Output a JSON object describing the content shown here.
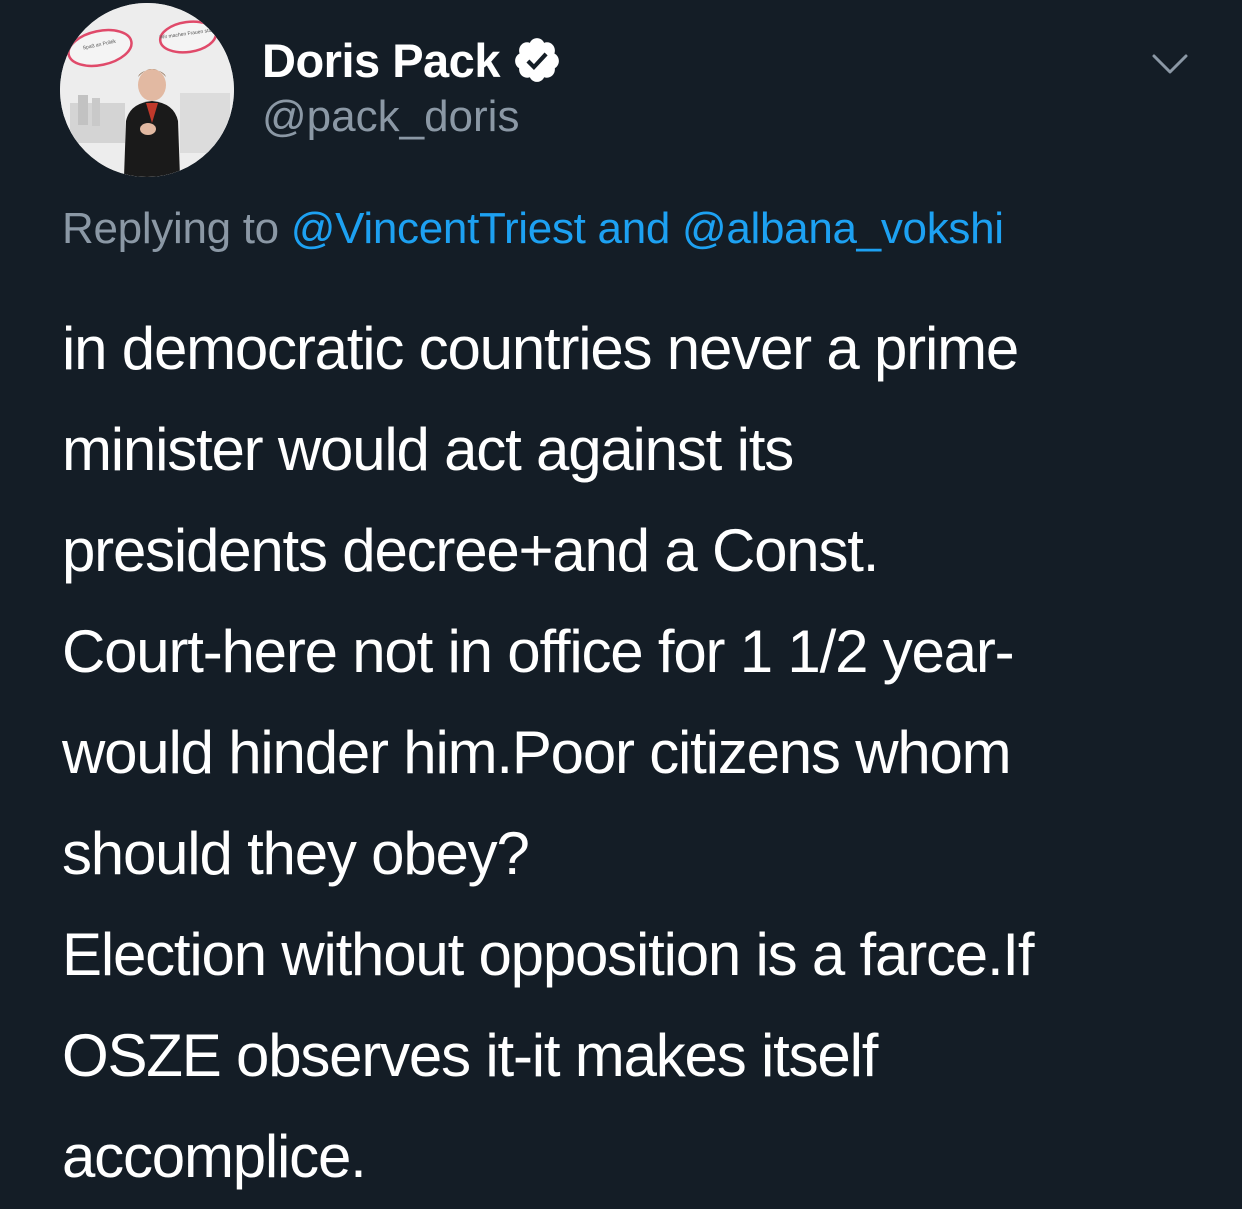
{
  "author": {
    "display_name": "Doris Pack",
    "handle": "@pack_doris",
    "verified": true,
    "avatar_signs": [
      "Spaß an Politik",
      "Wir machen Frauen stark"
    ]
  },
  "reply": {
    "prefix": "Replying to",
    "mention_1": "@VincentTriest",
    "conjunction": "and",
    "mention_2": "@albana_vokshi"
  },
  "body": {
    "lines": [
      "in democratic countries never a prime",
      "minister would act against its",
      "presidents decree+and a Const.",
      "Court-here not in office for 1 1/2 year-",
      "would hinder him.Poor citizens whom",
      "should they obey?",
      "Election without opposition is a farce.If",
      "OSZE observes it-it makes itself",
      "accomplice."
    ]
  },
  "icons": {
    "verified": "verified-badge-icon",
    "menu": "chevron-down-icon"
  },
  "colors": {
    "background": "#141d26",
    "text": "#ffffff",
    "secondary_text": "#8b98a5",
    "link": "#1da1f2"
  }
}
